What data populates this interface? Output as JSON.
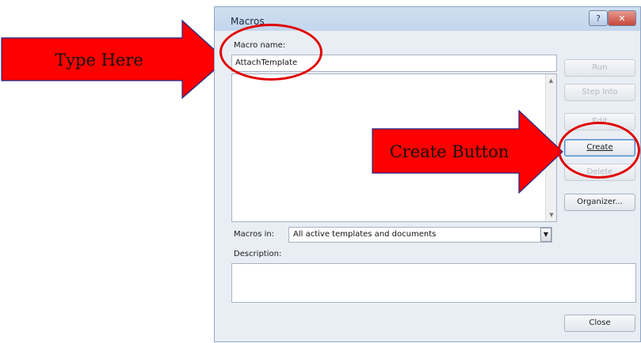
{
  "dialog": {
    "title": "Macros",
    "help_label": "?",
    "close_label": "✕",
    "macro_name_label": "Macro name:",
    "macro_name_value": "AttachTemplate",
    "macros_in_label": "Macros in:",
    "macros_in_value": "All active templates and documents",
    "description_label": "Description:",
    "buttons": {
      "run": "Run",
      "step_into": "Step Into",
      "edit": "Edit",
      "create": "Create",
      "delete": "Delete",
      "organizer": "Organizer...",
      "close": "Close"
    }
  },
  "annotations": {
    "type_here": "Type Here",
    "create_button": "Create Button"
  },
  "colors": {
    "arrow_red": "#ff0000",
    "oval_red": "#e00000",
    "title_bar": "#c3d6ec"
  }
}
